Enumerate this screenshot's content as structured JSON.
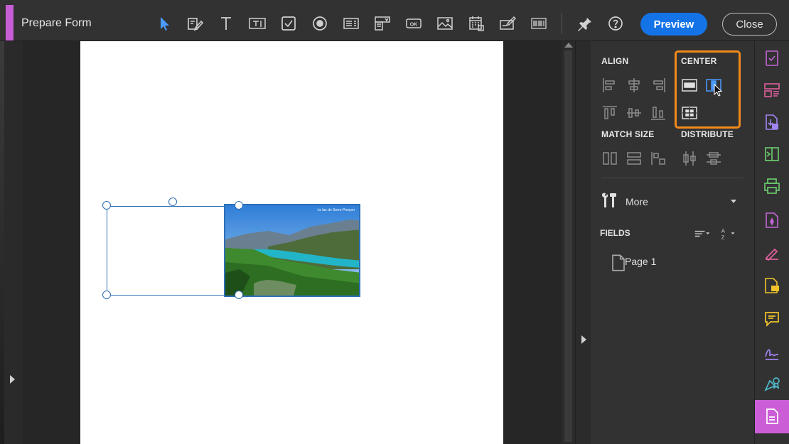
{
  "app": {
    "title": "Prepare Form",
    "accent_color": "#c85ed6"
  },
  "toolbar": {
    "tools": [
      {
        "name": "select-tool",
        "icon": "arrow-cursor-icon"
      },
      {
        "name": "edit-text-tool",
        "icon": "edit-icon"
      },
      {
        "name": "add-text-tool",
        "icon": "text-T-icon"
      },
      {
        "name": "text-field-tool",
        "icon": "text-field-icon"
      },
      {
        "name": "checkbox-tool",
        "icon": "checkbox-icon"
      },
      {
        "name": "radio-tool",
        "icon": "radio-icon"
      },
      {
        "name": "list-box-tool",
        "icon": "list-box-icon"
      },
      {
        "name": "dropdown-tool",
        "icon": "dropdown-icon"
      },
      {
        "name": "button-tool",
        "icon": "ok-button-icon"
      },
      {
        "name": "image-tool",
        "icon": "image-icon"
      },
      {
        "name": "date-tool",
        "icon": "calendar-icon"
      },
      {
        "name": "signature-tool",
        "icon": "signature-icon"
      },
      {
        "name": "barcode-tool",
        "icon": "barcode-icon"
      }
    ],
    "ok_label": "OK",
    "pin_icon": "pin-icon",
    "help_icon": "help-icon",
    "preview_label": "Preview",
    "close_label": "Close",
    "preview_color": "#1473e6"
  },
  "document": {
    "image_caption": "Le lac de Serre-Ponçon",
    "selection_color": "#2e6fb7"
  },
  "panel": {
    "align_label": "ALIGN",
    "center_label": "CENTER",
    "match_size_label": "MATCH SIZE",
    "distribute_label": "DISTRIBUTE",
    "more_label": "More",
    "fields_label": "FIELDS",
    "page_item": "Page 1",
    "highlight_color": "#f08a1c",
    "sort_label": "A Z"
  },
  "rail": {
    "items": [
      {
        "name": "rail-checklist",
        "color": "#c565d8"
      },
      {
        "name": "rail-organize",
        "color": "#e2609e"
      },
      {
        "name": "rail-export",
        "color": "#a184f2"
      },
      {
        "name": "rail-compress",
        "color": "#6cd16e"
      },
      {
        "name": "rail-print",
        "color": "#6cd16e"
      },
      {
        "name": "rail-protect",
        "color": "#c565d8"
      },
      {
        "name": "rail-fill-sign",
        "color": "#e2609e"
      },
      {
        "name": "rail-comment-doc",
        "color": "#f0c32b"
      },
      {
        "name": "rail-comment",
        "color": "#f0c32b"
      },
      {
        "name": "rail-sign",
        "color": "#a184f2"
      },
      {
        "name": "rail-certificates",
        "color": "#4fb8c9"
      },
      {
        "name": "rail-prepare-form",
        "color": "#ffffff"
      }
    ],
    "active_color": "#cb5ed6"
  }
}
